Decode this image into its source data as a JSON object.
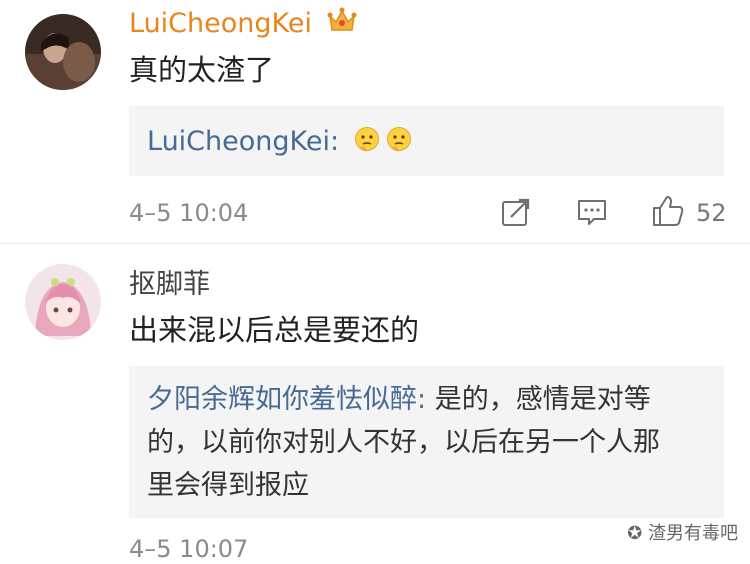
{
  "comments": [
    {
      "username": "LuiCheongKei",
      "badge_icon": "crown-icon",
      "text": "真的太渣了",
      "reply": {
        "user": "LuiCheongKei:",
        "emojis": [
          "thinking-emoji",
          "thinking-emoji"
        ]
      },
      "timestamp": "4–5 10:04",
      "like_count": "52",
      "colors": {
        "username": "#e8861b"
      }
    },
    {
      "username": "抠脚菲",
      "text": "出来混以后总是要还的",
      "reply": {
        "user": "夕阳余辉如你羞怯似醉:",
        "text_line1": " 是的，感情是对等",
        "text_line2": "的，以前你对别人不好，以后在另一个人那",
        "text_line3": "里会得到报应"
      },
      "timestamp": "4–5 10:07"
    }
  ],
  "colors": {
    "reply_user": "#466a93",
    "quote_bg": "#f4f4f4",
    "meta": "#8a8a8a"
  },
  "watermark": "渣男有毒吧"
}
